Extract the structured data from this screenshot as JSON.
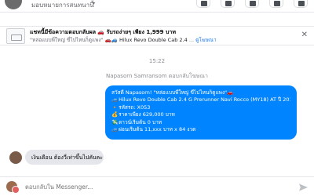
{
  "header": {
    "name": "มอบหมายการสนทนานี้",
    "caret": "▾"
  },
  "banner": {
    "title_prefix": "แชทนี้มีข้อความตอบกลับผล",
    "title_promo": "รับรถง่ายๆ เพียง 1,999 บาท",
    "sub_quote": "\"หล่อแบบพี่ใหญ่ ขี่ไปไหนก็ดูแพง\"",
    "sub_vehicle": "Hilux Revo Double Cab 2.4",
    "sub_link": "ดูโฆษณา",
    "close_label": "✕"
  },
  "thread": {
    "timestamp": "15:22",
    "sender_note": "Napasorn Samransom ตอบกลับโฆษณา",
    "out_bubble": {
      "line1": "สวัสดี Napasorn! \"หล่อแบบพี่ใหญ่ ขี่ไปไหนก็ดูแพง\"🚗",
      "line2_icon": "🚙",
      "line2": "Hilux Revo Double Cab 2.4 G Prerunner Navi Rocco (MY18) AT ปี 2019",
      "line3_icon": "🔸",
      "line3": "รหัสรถ: X053",
      "line4_icon": "💰",
      "line4": "ราคาเพียง 629,000 บาท",
      "line5_icon": "💸",
      "line5": "ดาวน์เริ่มต้น 0 บาท",
      "line6_icon": "🚙",
      "line6": "ผ่อนเริ่มต้น 11,xxx บาท x 84 งวด"
    },
    "in_bubble": "เงินเดือน ต้องวี่เท่าขึ้นไปคับคะ"
  },
  "composer": {
    "placeholder": "ตอบกลับใน Messenger..."
  },
  "colors": {
    "accent": "#0084ff",
    "incoming_bg": "#e4e6eb",
    "link": "#1877f2"
  }
}
